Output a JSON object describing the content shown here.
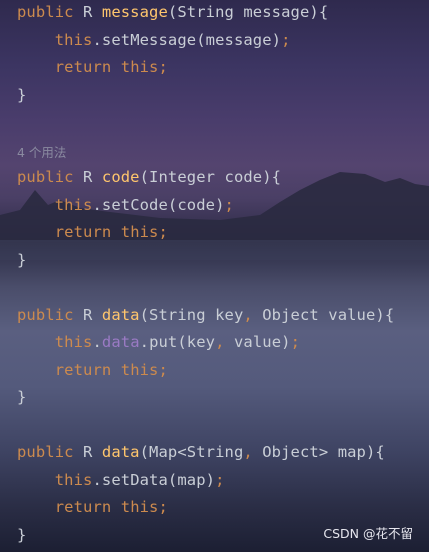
{
  "editor": {
    "lines": [
      {
        "id": "l1",
        "tokens": [
          [
            "kw",
            "public"
          ],
          [
            "pl",
            " R "
          ],
          [
            "fn",
            "message"
          ],
          [
            "pl",
            "(String message){"
          ]
        ]
      },
      {
        "id": "l2",
        "tokens": [
          [
            "pl",
            "    "
          ],
          [
            "kw",
            "this"
          ],
          [
            "pl",
            ".setMessage(message)"
          ],
          [
            "punc",
            ";"
          ]
        ]
      },
      {
        "id": "l3",
        "tokens": [
          [
            "pl",
            "    "
          ],
          [
            "kw",
            "return this"
          ],
          [
            "punc",
            ";"
          ]
        ]
      },
      {
        "id": "l4",
        "tokens": [
          [
            "pl",
            "}"
          ]
        ]
      },
      {
        "id": "l6",
        "tokens": [
          [
            "kw",
            "public"
          ],
          [
            "pl",
            " R "
          ],
          [
            "fn",
            "code"
          ],
          [
            "pl",
            "(Integer code){"
          ]
        ]
      },
      {
        "id": "l7",
        "tokens": [
          [
            "pl",
            "    "
          ],
          [
            "kw",
            "this"
          ],
          [
            "pl",
            ".setCode(code)"
          ],
          [
            "punc",
            ";"
          ]
        ]
      },
      {
        "id": "l8",
        "tokens": [
          [
            "pl",
            "    "
          ],
          [
            "kw",
            "return this"
          ],
          [
            "punc",
            ";"
          ]
        ]
      },
      {
        "id": "l9",
        "tokens": [
          [
            "pl",
            "}"
          ]
        ]
      },
      {
        "id": "l11",
        "tokens": [
          [
            "kw",
            "public"
          ],
          [
            "pl",
            " R "
          ],
          [
            "fn",
            "data"
          ],
          [
            "pl",
            "(String key"
          ],
          [
            "punc",
            ","
          ],
          [
            "pl",
            " Object value){"
          ]
        ]
      },
      {
        "id": "l12",
        "tokens": [
          [
            "pl",
            "    "
          ],
          [
            "kw",
            "this"
          ],
          [
            "pl",
            "."
          ],
          [
            "fld",
            "data"
          ],
          [
            "pl",
            ".put(key"
          ],
          [
            "punc",
            ","
          ],
          [
            "pl",
            " value)"
          ],
          [
            "punc",
            ";"
          ]
        ]
      },
      {
        "id": "l13",
        "tokens": [
          [
            "pl",
            "    "
          ],
          [
            "kw",
            "return this"
          ],
          [
            "punc",
            ";"
          ]
        ]
      },
      {
        "id": "l14",
        "tokens": [
          [
            "pl",
            "}"
          ]
        ]
      },
      {
        "id": "l16",
        "tokens": [
          [
            "kw",
            "public"
          ],
          [
            "pl",
            " R "
          ],
          [
            "fn",
            "data"
          ],
          [
            "pl",
            "(Map<String"
          ],
          [
            "punc",
            ","
          ],
          [
            "pl",
            " Object> map){"
          ]
        ]
      },
      {
        "id": "l17",
        "tokens": [
          [
            "pl",
            "    "
          ],
          [
            "kw",
            "this"
          ],
          [
            "pl",
            ".setData(map)"
          ],
          [
            "punc",
            ";"
          ]
        ]
      },
      {
        "id": "l18",
        "tokens": [
          [
            "pl",
            "    "
          ],
          [
            "kw",
            "return this"
          ],
          [
            "punc",
            ";"
          ]
        ]
      },
      {
        "id": "l19",
        "tokens": [
          [
            "pl",
            "}"
          ]
        ]
      }
    ],
    "usage_hint": "4 个用法"
  },
  "watermark": "CSDN @花不留",
  "colors": {
    "keyword": "#cc8a4e",
    "method": "#ffc66d",
    "field": "#9a7ac4",
    "plain": "#c9ced6"
  }
}
